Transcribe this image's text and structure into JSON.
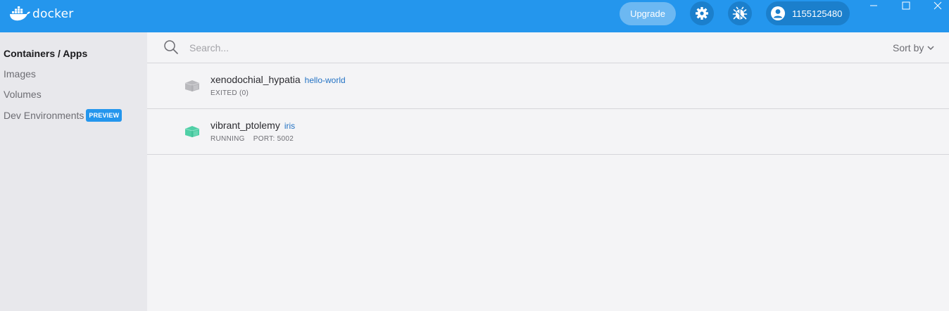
{
  "app": {
    "logo_text": "docker",
    "upgrade_label": "Upgrade",
    "account_name": "1155125480",
    "icons": {
      "settings": "gear-icon",
      "troubleshoot": "bug-icon",
      "account": "user-circle-icon"
    }
  },
  "sidebar": {
    "items": [
      {
        "label": "Containers / Apps",
        "active": true
      },
      {
        "label": "Images",
        "active": false
      },
      {
        "label": "Volumes",
        "active": false
      },
      {
        "label": "Dev Environments",
        "badge": "PREVIEW",
        "active": false
      }
    ]
  },
  "search": {
    "placeholder": "Search...",
    "value": ""
  },
  "sort": {
    "label": "Sort by"
  },
  "containers": [
    {
      "name": "xenodochial_hypatia",
      "image": "hello-world",
      "status": "EXITED (0)",
      "port": "",
      "state_color": "#b9b9bd"
    },
    {
      "name": "vibrant_ptolemy",
      "image": "iris",
      "status": "RUNNING",
      "port": "PORT: 5002",
      "state_color": "#4fcfa6"
    }
  ],
  "colors": {
    "brand": "#2496ed",
    "link": "#2473c4"
  }
}
